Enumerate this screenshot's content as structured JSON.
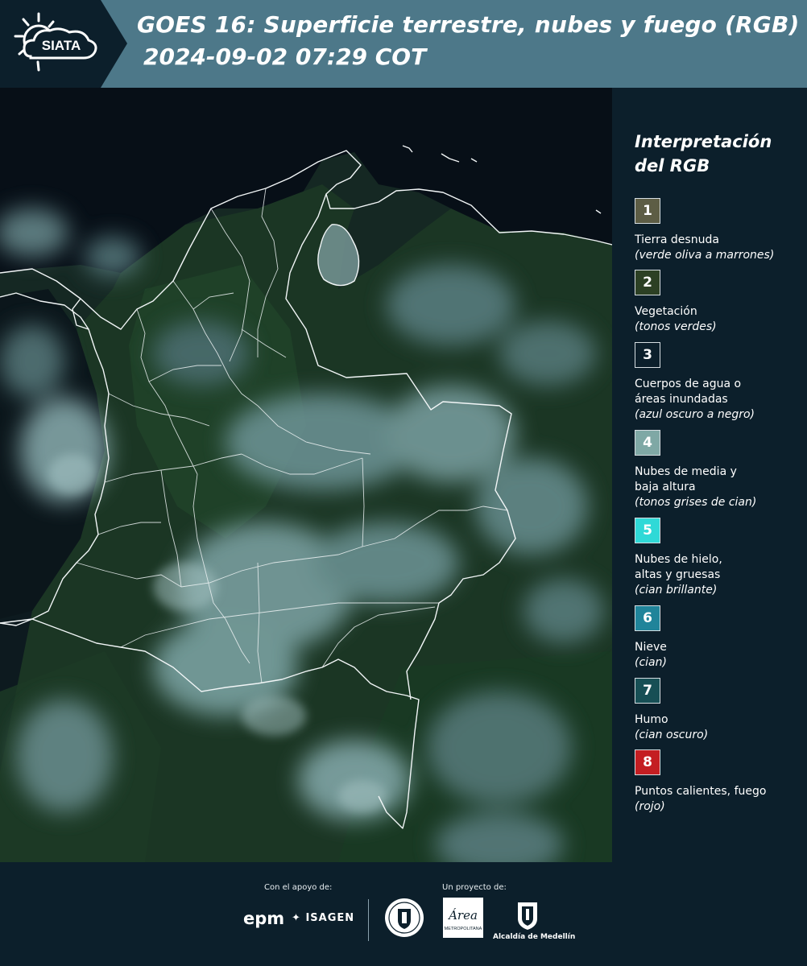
{
  "header": {
    "logo_text": "SIATA",
    "title_line1": "GOES 16: Superficie terrestre, nubes y fuego (RGB)",
    "title_line2": "2024-09-02 07:29 COT"
  },
  "legend": {
    "title_line1": "Interpretación",
    "title_line2": "del RGB",
    "items": [
      {
        "num": "1",
        "label": "Tierra desnuda",
        "desc": "(verde oliva a marrones)",
        "color": "#5d5d45"
      },
      {
        "num": "2",
        "label": "Vegetación",
        "desc": "(tonos verdes)",
        "color": "#2c4024"
      },
      {
        "num": "3",
        "label": "Cuerpos de agua o áreas inundadas",
        "desc": "(azul oscuro a negro)",
        "color": "#0c1f2b"
      },
      {
        "num": "4",
        "label": "Nubes de media y baja altura",
        "desc": "(tonos grises de cian)",
        "color": "#7fa8a5"
      },
      {
        "num": "5",
        "label": "Nubes de hielo, altas y gruesas",
        "desc": "(cian brillante)",
        "color": "#2fd9d7"
      },
      {
        "num": "6",
        "label": "Nieve",
        "desc": "(cian)",
        "color": "#20849a"
      },
      {
        "num": "7",
        "label": "Humo",
        "desc": "(cian oscuro)",
        "color": "#174f55"
      },
      {
        "num": "8",
        "label": "Puntos calientes, fuego",
        "desc": "(rojo)",
        "color": "#c41e22"
      }
    ]
  },
  "footer": {
    "support_caption": "Con el apoyo de:",
    "project_caption": "Un proyecto de:",
    "epm": "epm",
    "isagen": "ISAGEN",
    "area_word": "Área",
    "area_sub": "METROPOLITANA",
    "medellin": "Alcaldía de Medellín"
  },
  "colors": {
    "header_bg": "#4d7889",
    "panel_bg": "#0c1f2b",
    "ocean": "#081119",
    "land": "#1d3a26",
    "cloud": "#6f9b9c"
  }
}
